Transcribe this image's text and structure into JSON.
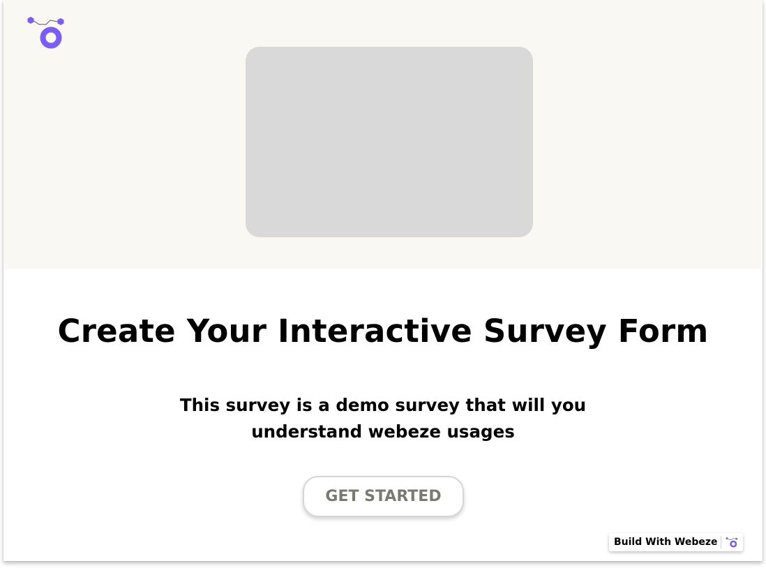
{
  "brand": {
    "logo_icon": "webeze-logo-icon",
    "accent_color": "#7b5cf6"
  },
  "hero": {
    "image_placeholder": "image-placeholder"
  },
  "main": {
    "title": "Create Your Interactive Survey Form",
    "subtitle_line1": "This survey is a demo survey that will you",
    "subtitle_line2": "understand webeze usages",
    "cta_label": "GET STARTED"
  },
  "footer_badge": {
    "label": "Build With Webeze",
    "icon": "webeze-logo-icon"
  }
}
